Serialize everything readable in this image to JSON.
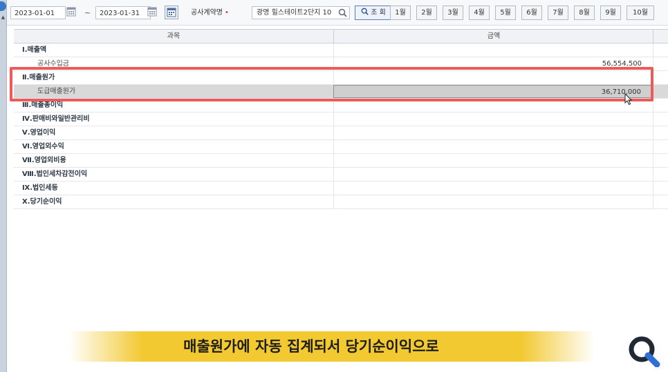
{
  "toolbar": {
    "date_from": "2023-01-01",
    "date_sep": "~",
    "date_to": "2023-01-31",
    "contract_label": "공사계약명",
    "required_mark": "•",
    "contract_value": "광명 힐스테이트2단지 10",
    "query_button": "조 회",
    "months": [
      "1월",
      "2월",
      "3월",
      "4월",
      "5월",
      "6월",
      "7월",
      "8월",
      "9월",
      "10월"
    ]
  },
  "grid": {
    "columns": [
      "과목",
      "금액"
    ],
    "rows": [
      {
        "label": "Ⅰ.매출액",
        "amount": "",
        "kind": "section"
      },
      {
        "label": "공사수입금",
        "amount": "56,554,500",
        "kind": "sub"
      },
      {
        "label": "Ⅱ.매출원가",
        "amount": "",
        "kind": "section"
      },
      {
        "label": "도급매출원가",
        "amount": "36,710,000",
        "kind": "sub"
      },
      {
        "label": "Ⅲ.매출총이익",
        "amount": "",
        "kind": "section"
      },
      {
        "label": "Ⅳ.판매비와일반관리비",
        "amount": "",
        "kind": "section"
      },
      {
        "label": "Ⅴ.영업이익",
        "amount": "",
        "kind": "section"
      },
      {
        "label": "Ⅵ.영업외수익",
        "amount": "",
        "kind": "section"
      },
      {
        "label": "Ⅶ.영업외비용",
        "amount": "",
        "kind": "section"
      },
      {
        "label": "Ⅷ.법인세차감전이익",
        "amount": "",
        "kind": "section"
      },
      {
        "label": "Ⅸ.법인세등",
        "amount": "",
        "kind": "section"
      },
      {
        "label": "Ⅹ.당기순이익",
        "amount": "",
        "kind": "section"
      }
    ],
    "selected_row": 3
  },
  "caption": "매출원가에 자동 집계되서 당기순이익으로",
  "colors": {
    "highlight": "#ee5a5a",
    "caption_band": "#f3c931",
    "logo_blue": "#2f6fd6"
  },
  "icons": [
    "calendar-icon",
    "search-icon",
    "mouse-cursor-icon",
    "magnifier-logo-icon"
  ]
}
